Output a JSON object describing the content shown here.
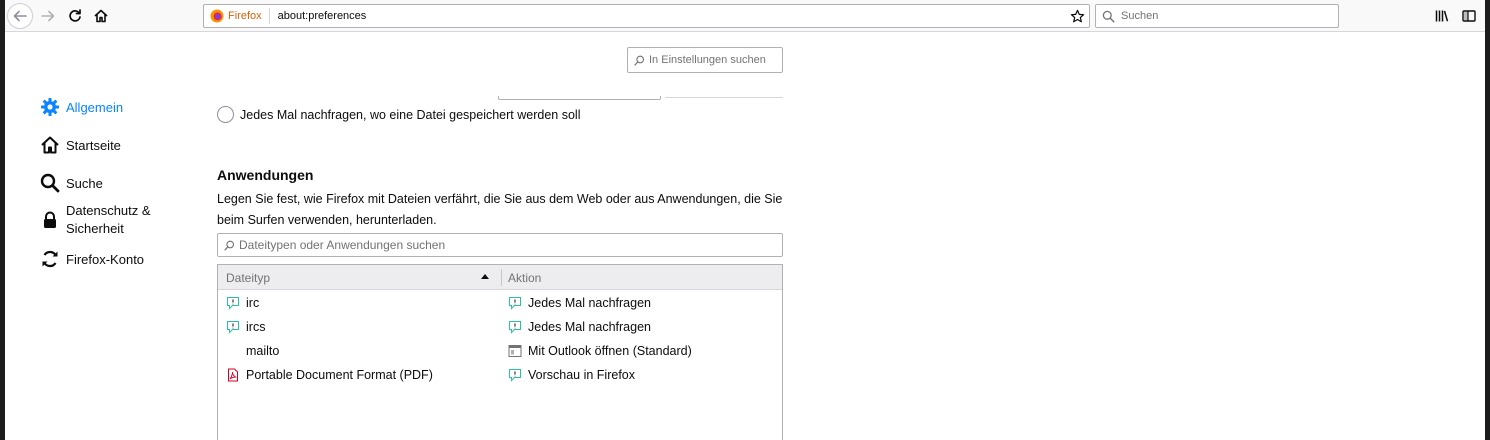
{
  "toolbar": {
    "identity_label": "Firefox",
    "url": "about:preferences",
    "search_placeholder": "Suchen",
    "icons": [
      "back-arrow-icon",
      "forward-arrow-icon",
      "reload-icon",
      "home-icon",
      "firefox-logo-icon",
      "bookmark-star-icon",
      "search-icon",
      "library-icon",
      "sidebar-icon"
    ]
  },
  "prefs": {
    "search_placeholder": "In Einstellungen suchen",
    "nav": [
      {
        "label": "Allgemein",
        "icon": "gear-icon",
        "selected": true
      },
      {
        "label": "Startseite",
        "icon": "home-icon"
      },
      {
        "label": "Suche",
        "icon": "search-icon"
      },
      {
        "label": "Datenschutz & Sicherheit",
        "icon": "lock-icon"
      },
      {
        "label": "Firefox-Konto",
        "icon": "sync-icon"
      }
    ],
    "ask_save_location_label": "Jedes Mal nachfragen, wo eine Datei gespeichert werden soll",
    "applications": {
      "title": "Anwendungen",
      "description": "Legen Sie fest, wie Firefox mit Dateien verfährt, die Sie aus dem Web oder aus Anwendungen, die Sie beim Surfen verwenden, herunterladen.",
      "search_placeholder": "Dateitypen oder Anwendungen suchen",
      "columns": {
        "type": "Dateityp",
        "action": "Aktion"
      },
      "rows": [
        {
          "type": "irc",
          "type_icon": "chat-icon",
          "action": "Jedes Mal nachfragen",
          "action_icon": "chat-icon"
        },
        {
          "type": "ircs",
          "type_icon": "chat-icon",
          "action": "Jedes Mal nachfragen",
          "action_icon": "chat-icon"
        },
        {
          "type": "mailto",
          "type_icon": "",
          "action": "Mit Outlook öffnen (Standard)",
          "action_icon": "application-icon"
        },
        {
          "type": "Portable Document Format (PDF)",
          "type_icon": "pdf-icon",
          "action": "Vorschau in Firefox",
          "action_icon": "chat-icon"
        }
      ]
    }
  },
  "colors": {
    "accent": "#0a84ff",
    "identity": "#d7630a",
    "pdf": "#d70022",
    "chat": "#2ac3a2"
  }
}
